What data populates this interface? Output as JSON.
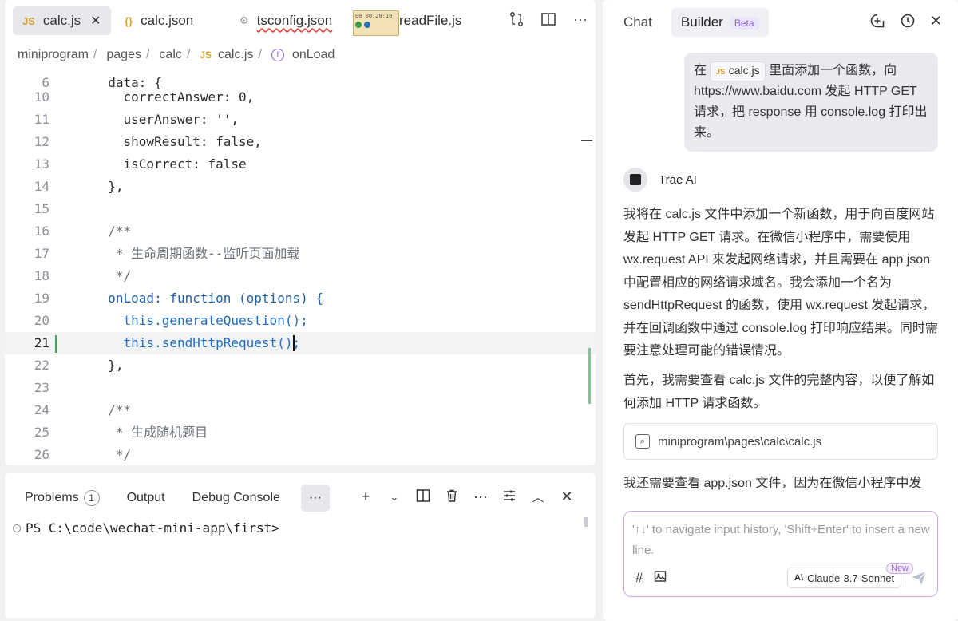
{
  "editor": {
    "tabs": [
      {
        "icon": "JS",
        "label": "calc.js",
        "close": "✕"
      },
      {
        "icon": "{}",
        "label": "calc.json"
      },
      {
        "icon": "⚙",
        "label": "tsconfig.json"
      },
      {
        "label": "readFile.js"
      }
    ],
    "thumb_text": [
      "00 00:20:10"
    ],
    "breadcrumb": [
      "miniprogram",
      "pages",
      "calc",
      "calc.js",
      "onLoad"
    ],
    "breadcrumb_js": "JS",
    "breadcrumb_fn": "f",
    "lines": [
      {
        "n": "6",
        "t": "  data: {"
      },
      {
        "n": "10",
        "t": "    correctAnswer: 0,"
      },
      {
        "n": "11",
        "t": "    userAnswer: '',"
      },
      {
        "n": "12",
        "t": "    showResult: false,"
      },
      {
        "n": "13",
        "t": "    isCorrect: false"
      },
      {
        "n": "14",
        "t": "  },"
      },
      {
        "n": "15",
        "t": ""
      },
      {
        "n": "16",
        "t": "  /**"
      },
      {
        "n": "17",
        "t": "   * 生命周期函数--监听页面加载"
      },
      {
        "n": "18",
        "t": "   */"
      },
      {
        "n": "19",
        "t": "  onLoad: function (options) {"
      },
      {
        "n": "20",
        "t": "    this.generateQuestion();"
      },
      {
        "n": "21",
        "t": "    this.sendHttpRequest();"
      },
      {
        "n": "22",
        "t": "  },"
      },
      {
        "n": "23",
        "t": ""
      },
      {
        "n": "24",
        "t": "  /**"
      },
      {
        "n": "25",
        "t": "   * 生成随机题目"
      },
      {
        "n": "26",
        "t": "   */"
      }
    ]
  },
  "terminal": {
    "tabs": [
      {
        "label": "Problems",
        "badge": "1"
      },
      {
        "label": "Output"
      },
      {
        "label": "Debug Console"
      }
    ],
    "more": "···",
    "prompt": "PS C:\\code\\wechat-mini-app\\first>"
  },
  "chat": {
    "tabs": {
      "chat": "Chat",
      "builder": "Builder",
      "beta": "Beta"
    },
    "user_message": {
      "prefix": "在",
      "chip_icon": "JS",
      "chip_label": "calc.js",
      "suffix": "里面添加一个函数，向 https://www.baidu.com 发起 HTTP GET 请求，把 response 用 console.log 打印出来。"
    },
    "ai_name": "Trae AI",
    "ai_paragraphs": [
      "我将在 calc.js 文件中添加一个新函数，用于向百度网站发起 HTTP GET 请求。在微信小程序中，需要使用 wx.request API 来发起网络请求，并且需要在 app.json 中配置相应的网络请求域名。我会添加一个名为 sendHttpRequest 的函数，使用 wx.request 发起请求，并在回调函数中通过 console.log 打印响应结果。同时需要注意处理可能的错误情况。",
      "首先，我需要查看 calc.js 文件的完整内容，以便了解如何添加 HTTP 请求函数。",
      "我还需要查看 app.json 文件，因为在微信小程序中发"
    ],
    "file_card": "miniprogram\\pages\\calc\\calc.js",
    "input_placeholder": "'↑↓' to navigate input history, 'Shift+Enter' to insert a new line.",
    "model": "Claude-3.7-Sonnet",
    "new_badge": "New"
  }
}
